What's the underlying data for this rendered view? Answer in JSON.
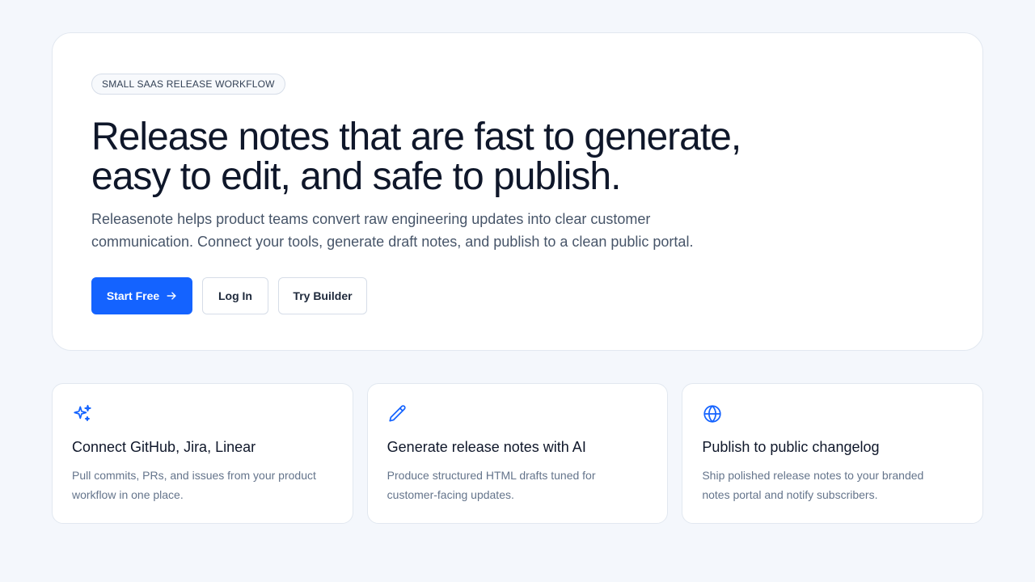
{
  "hero": {
    "badge": "SMALL SAAS RELEASE WORKFLOW",
    "headline_line1": "Release notes that are fast to generate,",
    "headline_line2": "easy to edit, and safe to publish.",
    "lede": "Releasenote helps product teams convert raw engineering updates into clear customer communication. Connect your tools, generate draft notes, and publish to a clean public portal.",
    "actions": {
      "start_free": "Start Free",
      "log_in": "Log In",
      "try_builder": "Try Builder"
    }
  },
  "features": [
    {
      "icon": "sparkles-icon",
      "title": "Connect GitHub, Jira, Linear",
      "text": "Pull commits, PRs, and issues from your product workflow in one place."
    },
    {
      "icon": "pencil-icon",
      "title": "Generate release notes with AI",
      "text": "Produce structured HTML drafts tuned for customer-facing updates."
    },
    {
      "icon": "globe-icon",
      "title": "Publish to public changelog",
      "text": "Ship polished release notes to your branded notes portal and notify subscribers."
    }
  ],
  "colors": {
    "accent": "#1463ff",
    "background": "#f4f7fc",
    "heading": "#0f172a",
    "body_text": "#475569",
    "muted_text": "#64748b",
    "border": "#e2e8f0"
  }
}
